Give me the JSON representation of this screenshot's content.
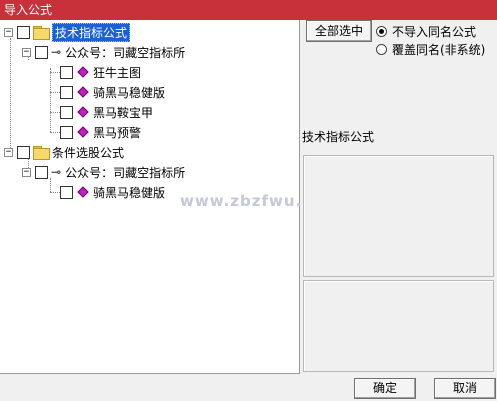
{
  "window": {
    "title": "导入公式"
  },
  "tree": {
    "groups": [
      {
        "label": "技术指标公式",
        "account": "公众号：司藏空指标所",
        "items": [
          "狂牛主图",
          "骑黑马稳健版",
          "黑马鞍宝甲",
          "黑马预警"
        ]
      },
      {
        "label": "条件选股公式",
        "account": "公众号：司藏空指标所",
        "items": [
          "骑黑马稳健版"
        ]
      }
    ]
  },
  "options": {
    "select_all_label": "全部选中",
    "radio_no_import_label": "不导入同名公式",
    "radio_overwrite_label": "覆盖同名(非系统)",
    "selected_option": "no_import"
  },
  "description": {
    "title": "技术指标公式"
  },
  "footer": {
    "ok_label": "确定",
    "cancel_label": "取消"
  },
  "watermark": "www.zbzfwu.com",
  "colors": {
    "titlebar": "#c8303a",
    "selection": "#1c5fd6",
    "formula_icon": "#c020c0"
  }
}
